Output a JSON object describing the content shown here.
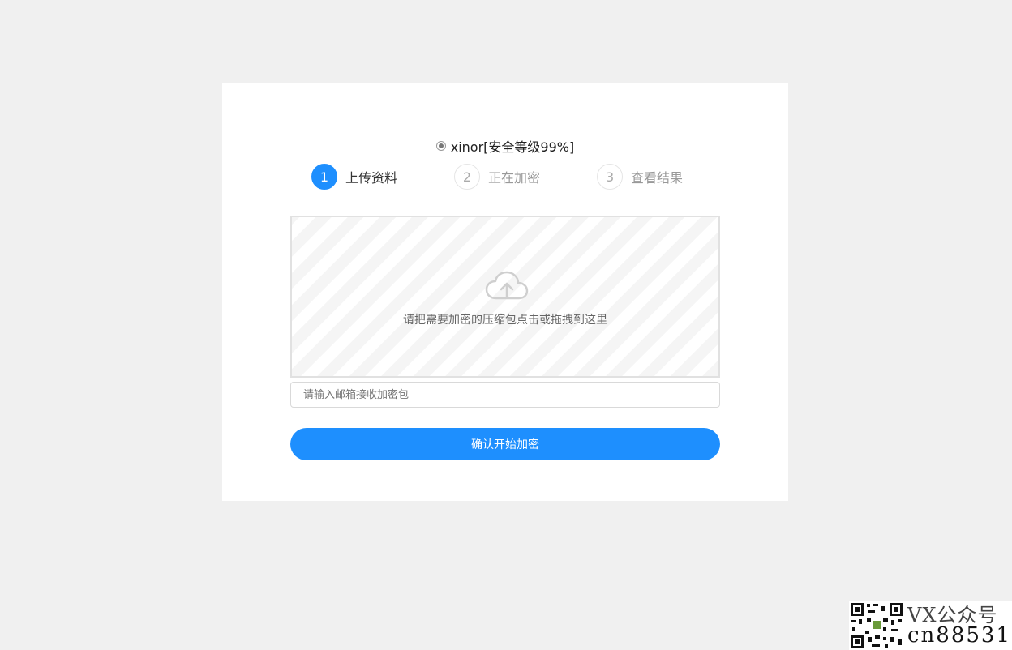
{
  "algorithm": {
    "label": "xinor[安全等级99%]",
    "selected": true
  },
  "steps": [
    {
      "number": "1",
      "label": "上传资料",
      "active": true
    },
    {
      "number": "2",
      "label": "正在加密",
      "active": false
    },
    {
      "number": "3",
      "label": "查看结果",
      "active": false
    }
  ],
  "dropzone": {
    "icon": "cloud-upload-icon",
    "text": "请把需要加密的压缩包点击或拖拽到这里"
  },
  "email": {
    "placeholder": "请输入邮箱接收加密包",
    "value": ""
  },
  "submit": {
    "label": "确认开始加密"
  },
  "watermark": {
    "line1": "VX公众号",
    "line2": "cn88531"
  },
  "colors": {
    "accent": "#1e8ffe",
    "background": "#f0f0f0"
  }
}
